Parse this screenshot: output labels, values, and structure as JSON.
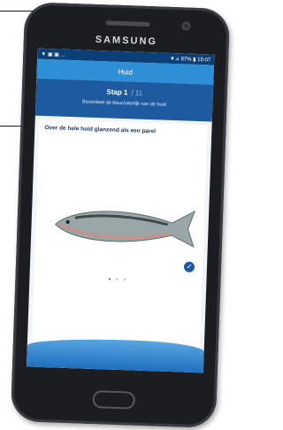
{
  "device": {
    "brand": "SAMSUNG"
  },
  "status_bar": {
    "left_icons": "▼ ▣ ▣ ...",
    "right_text": "▼⊿ 87% ▮ 15:07"
  },
  "app": {
    "title": "Huid",
    "step_label": "Stap 1",
    "step_total": "/ 11",
    "step_description": "Beoordeel de kleur/uiterlijk van de huid"
  },
  "card": {
    "title": "Over de hele huid glanzend als een parel"
  },
  "pager": {
    "dots": [
      "•",
      "•",
      "•"
    ],
    "active_index": 0
  },
  "icons": {
    "check": "check-icon"
  },
  "colors": {
    "status": "#0a3f78",
    "appbar": "#2e8fd6",
    "step": "#1d5aa0",
    "accent": "#1d5aa0"
  }
}
